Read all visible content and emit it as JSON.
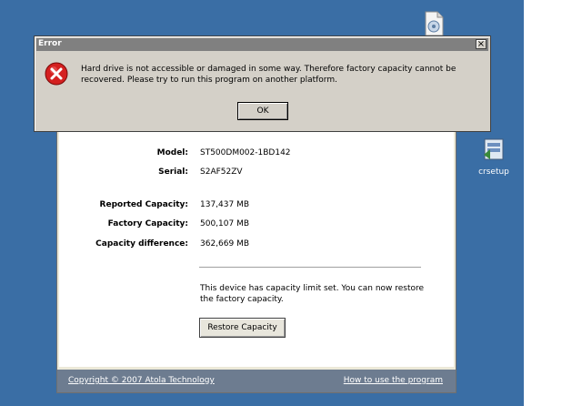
{
  "desktop": {
    "icons": [
      {
        "name": "top-icon",
        "label": ""
      },
      {
        "name": "crsetup",
        "label": "crsetup"
      }
    ]
  },
  "app": {
    "fields": {
      "model_label": "Model:",
      "model_value": "ST500DM002-1BD142",
      "serial_label": "Serial:",
      "serial_value": "S2AF52ZV",
      "reported_label": "Reported Capacity:",
      "reported_value": "137,437 MB",
      "factory_label": "Factory Capacity:",
      "factory_value": "500,107 MB",
      "difference_label": "Capacity difference:",
      "difference_value": "362,669 MB"
    },
    "message": "This device has capacity limit set. You can now restore the factory capacity.",
    "restore_button": "Restore Capacity",
    "footer": {
      "copyright": "Copyright © 2007 Atola Technology",
      "help_link": "How to use the program"
    }
  },
  "dialog": {
    "title": "Error",
    "close_symbol": "×",
    "message": "Hard drive is not accessible or damaged in some way. Therefore factory capacity cannot be recovered. Please try to run this program on another platform.",
    "ok_label": "OK",
    "icon": "error-icon"
  }
}
